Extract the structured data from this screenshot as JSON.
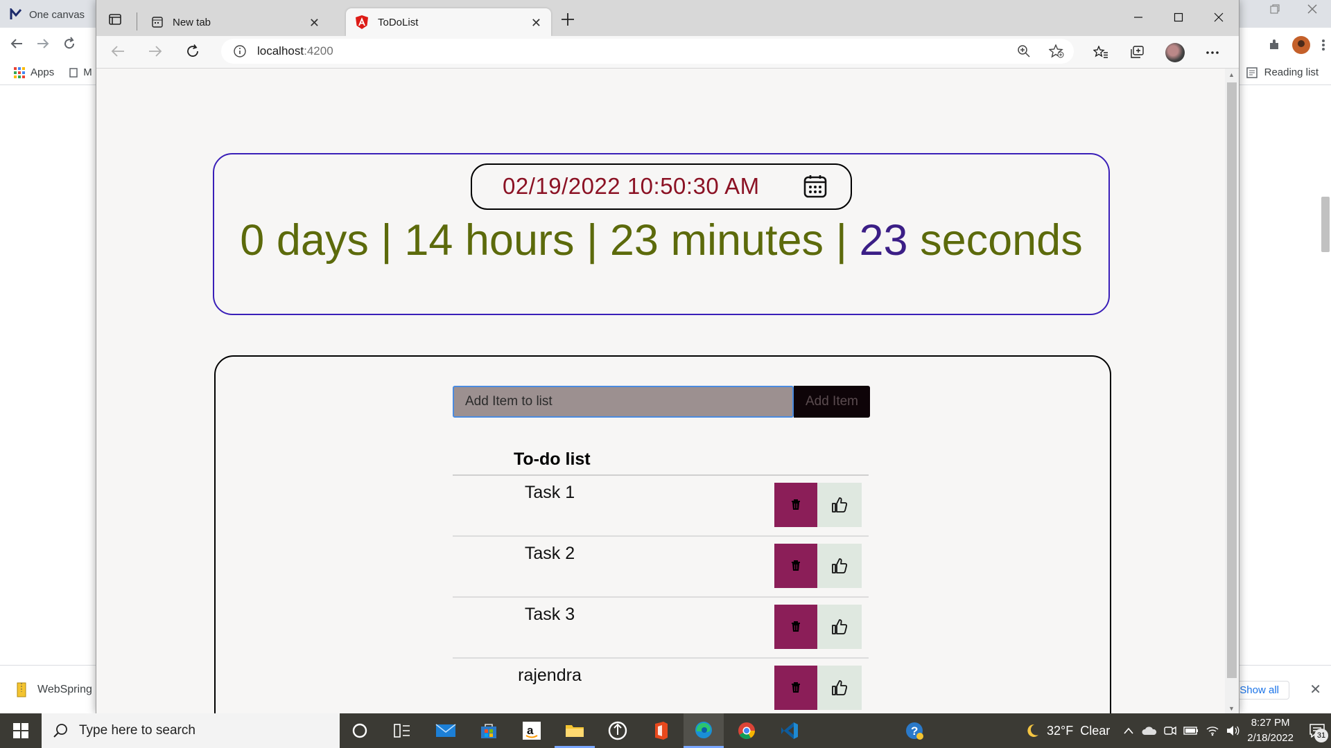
{
  "back_browser": {
    "tab_title": "One canvas",
    "bookmarks": {
      "apps_label": "Apps",
      "partial_label": "M",
      "reading_list_label": "Reading list"
    },
    "download": {
      "file_name": "WebSpring",
      "show_all_label": "Show all"
    }
  },
  "edge": {
    "tabs": [
      {
        "title": "New tab"
      },
      {
        "title": "ToDoList"
      }
    ],
    "address": {
      "host": "localhost",
      "port": ":4200"
    }
  },
  "timer": {
    "date_value": "02/19/2022 10:50:30 AM",
    "countdown": {
      "days": "0 days",
      "hours": "14 hours",
      "minutes": "23 minutes",
      "seconds_number": "23",
      "seconds_unit": "seconds",
      "separator": "|"
    }
  },
  "todo": {
    "input_placeholder": "Add Item to list",
    "add_button_label": "Add Item",
    "list_title": "To-do list",
    "items": [
      {
        "label": "Task 1"
      },
      {
        "label": "Task 2"
      },
      {
        "label": "Task 3"
      },
      {
        "label": "rajendra"
      }
    ]
  },
  "taskbar": {
    "search_placeholder": "Type here to search",
    "weather_temp": "32°F",
    "weather_desc": "Clear",
    "time": "8:27 PM",
    "date": "2/18/2022",
    "notification_count": "31"
  },
  "colors": {
    "date_text": "#8b1224",
    "countdown_text": "#5c6a0b",
    "seconds_number": "#3b1e86",
    "timer_border": "#3a1fb8",
    "delete_button": "#8b1e58",
    "like_button": "#dfe8e0",
    "input_bg": "#9c9090"
  }
}
